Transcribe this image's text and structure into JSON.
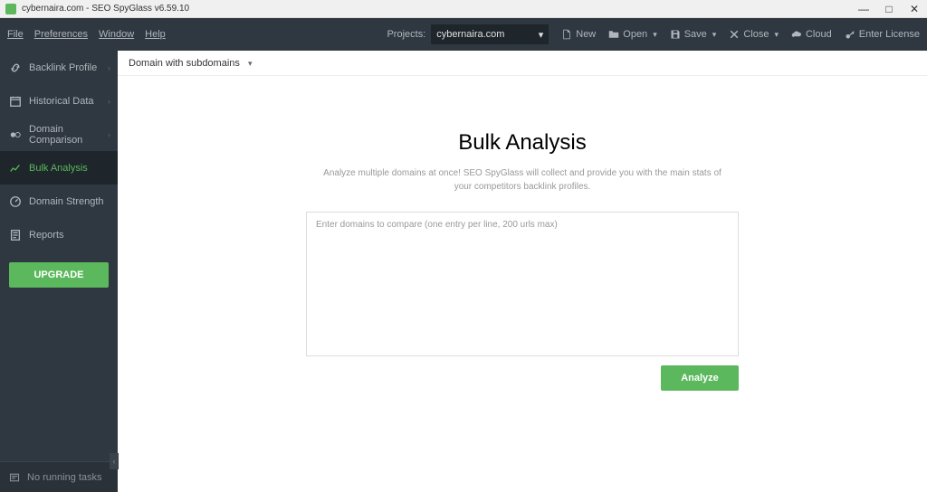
{
  "titlebar": {
    "text": "cybernaira.com - SEO SpyGlass v6.59.10"
  },
  "menubar": {
    "items": [
      "File",
      "Preferences",
      "Window",
      "Help"
    ],
    "projects_label": "Projects:",
    "project_selected": "cybernaira.com",
    "buttons": {
      "new": "New",
      "open": "Open",
      "save": "Save",
      "close": "Close",
      "cloud": "Cloud",
      "license": "Enter License"
    }
  },
  "sidebar": {
    "items": [
      {
        "label": "Backlink Profile",
        "expandable": true
      },
      {
        "label": "Historical Data",
        "expandable": true
      },
      {
        "label": "Domain Comparison",
        "expandable": true
      },
      {
        "label": "Bulk Analysis",
        "expandable": false,
        "active": true
      },
      {
        "label": "Domain Strength",
        "expandable": false
      },
      {
        "label": "Reports",
        "expandable": false
      }
    ],
    "upgrade": "UPGRADE",
    "footer": "No running tasks"
  },
  "content": {
    "toolbar_mode": "Domain with subdomains",
    "heading": "Bulk Analysis",
    "subtitle": "Analyze multiple domains at once! SEO SpyGlass will collect and provide you with the main stats of your competitors backlink profiles.",
    "placeholder": "Enter domains to compare (one entry per line, 200 urls max)",
    "analyze_btn": "Analyze"
  }
}
